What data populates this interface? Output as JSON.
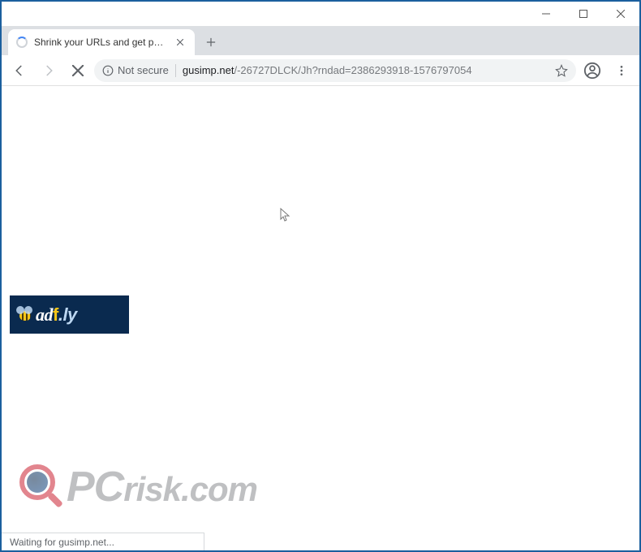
{
  "window": {
    "minimize_label": "Minimize",
    "maximize_label": "Maximize",
    "close_label": "Close"
  },
  "tabs": [
    {
      "title": "Shrink your URLs and get paid!",
      "loading": true
    }
  ],
  "toolbar": {
    "back_label": "Back",
    "forward_label": "Forward",
    "stop_label": "Stop",
    "security_text": "Not secure",
    "url_domain": "gusimp.net",
    "url_path": "/-26727DLCK/Jh?rndad=2386293918-1576797054",
    "bookmark_label": "Bookmark this page",
    "account_label": "Account",
    "menu_label": "Customize and control"
  },
  "page": {
    "adfly_logo_text": "adf.ly",
    "watermark_text": "PCrisk.com"
  },
  "statusbar": {
    "text": "Waiting for gusimp.net..."
  }
}
